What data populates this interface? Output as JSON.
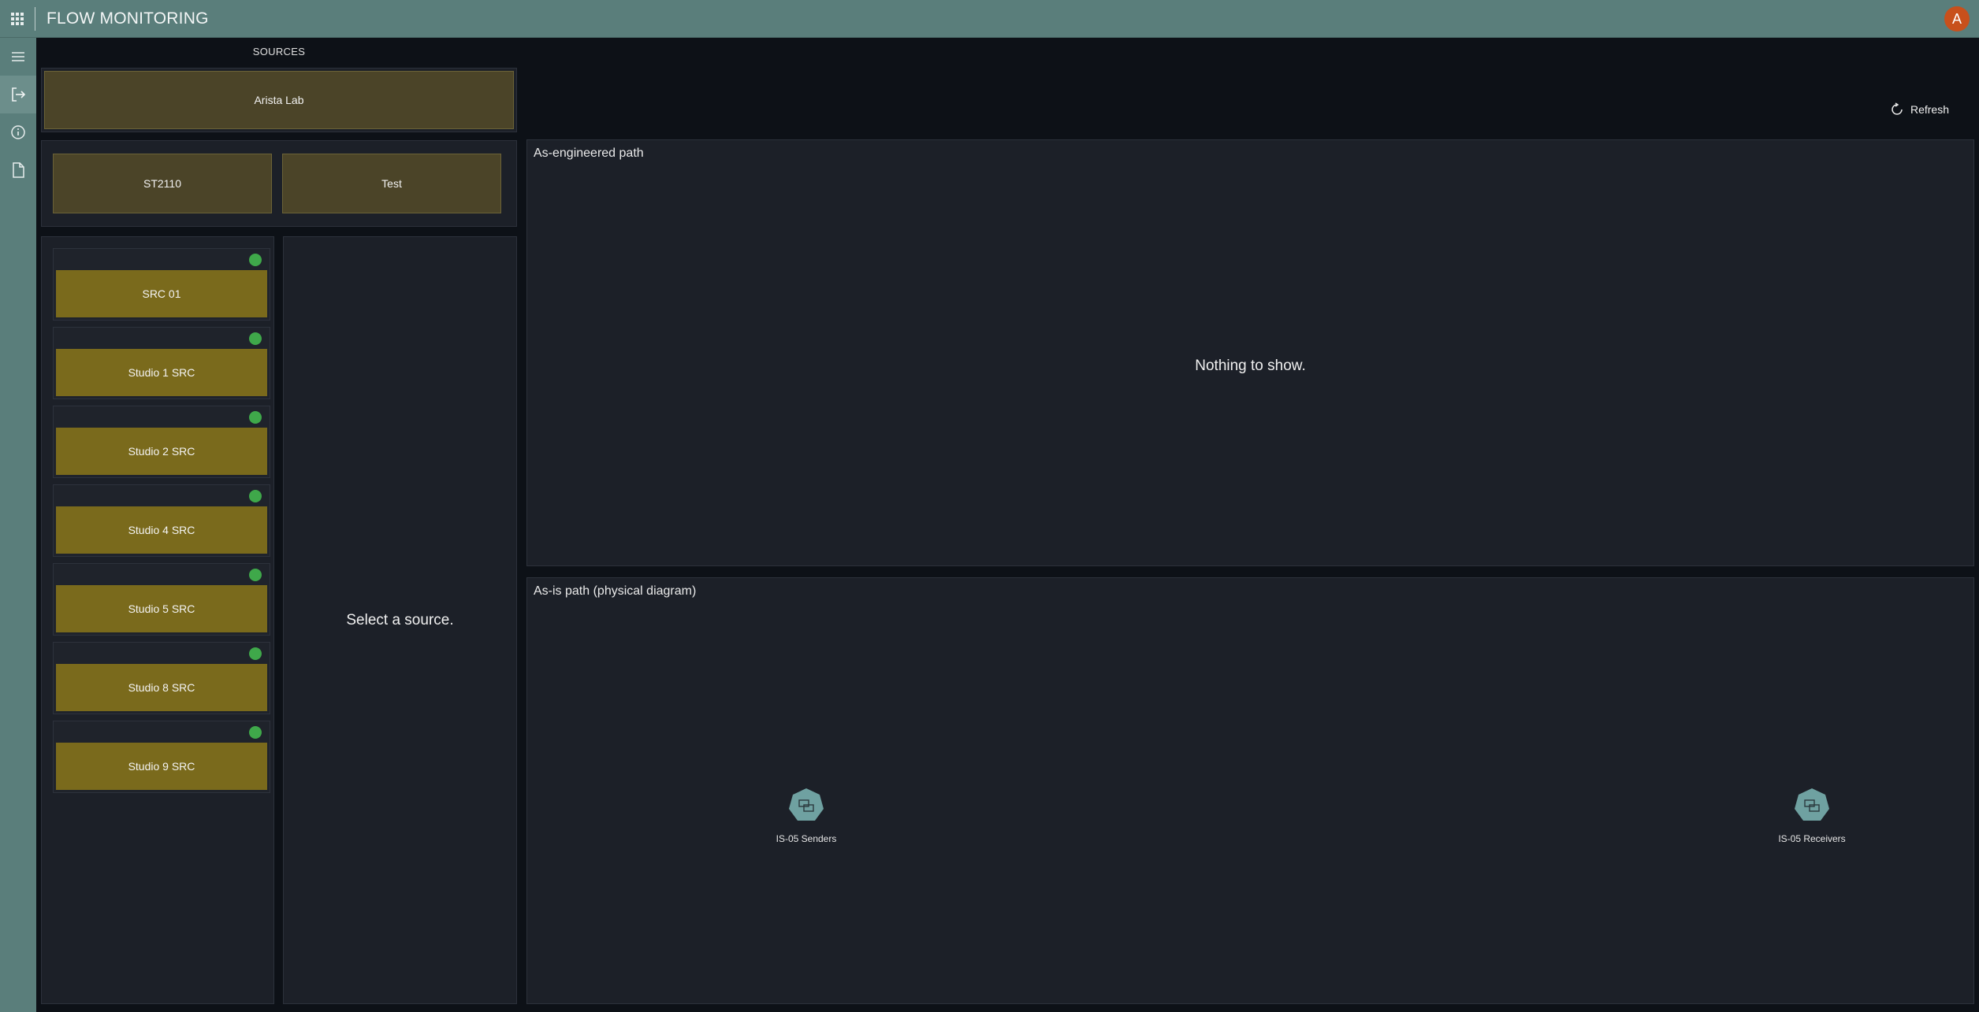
{
  "header": {
    "title": "FLOW MONITORING",
    "apps_icon": "apps-grid-icon",
    "avatar_letter": "A",
    "avatar_color": "#c8501c",
    "bar_color": "#5a7e7b"
  },
  "rail": {
    "items": [
      {
        "icon": "hamburger-menu-icon"
      },
      {
        "icon": "exit-arrow-icon"
      },
      {
        "icon": "info-icon"
      },
      {
        "icon": "document-icon"
      }
    ]
  },
  "sources": {
    "title": "SOURCES",
    "group": "Arista Lab",
    "tabs": [
      "ST2110",
      "Test"
    ],
    "items": [
      {
        "label": "SRC 01",
        "status": "online"
      },
      {
        "label": "Studio 1 SRC",
        "status": "online"
      },
      {
        "label": "Studio 2 SRC",
        "status": "online"
      },
      {
        "label": "Studio 4 SRC",
        "status": "online"
      },
      {
        "label": "Studio 5 SRC",
        "status": "online"
      },
      {
        "label": "Studio 8 SRC",
        "status": "online"
      },
      {
        "label": "Studio 9 SRC",
        "status": "online"
      }
    ],
    "status_color": "#3fa84a",
    "source_button_color": "#7a6a1c",
    "empty_detail": "Select a source."
  },
  "toolbar": {
    "refresh_label": "Refresh"
  },
  "engineered": {
    "title": "As-engineered path",
    "empty": "Nothing to show."
  },
  "physical": {
    "title": "As-is path (physical diagram)",
    "nodes": [
      {
        "label": "IS-05 Senders"
      },
      {
        "label": "IS-05 Receivers"
      }
    ],
    "node_color": "#6fa1a1"
  }
}
